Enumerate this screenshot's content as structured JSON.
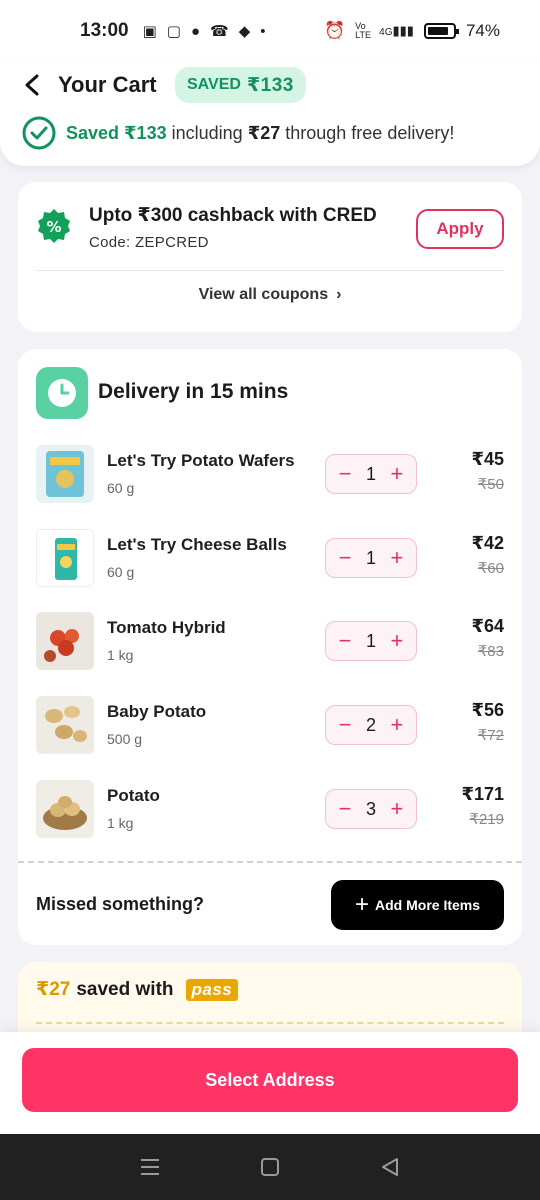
{
  "status_bar": {
    "time": "13:00",
    "network": "4G",
    "volte": "Vo LTE",
    "battery": "74%"
  },
  "header": {
    "title": "Your Cart",
    "saved_badge_label": "SAVED",
    "saved_badge_amount": "₹133",
    "saved_amount": "Saved ₹133",
    "saved_middle": "including",
    "delivery_saving": "₹27",
    "saved_suffix": "through free delivery!"
  },
  "coupon": {
    "title": "Upto ₹300 cashback with CRED",
    "code": "Code: ZEPCRED",
    "apply_label": "Apply",
    "view_all_label": "View all coupons"
  },
  "delivery": {
    "title": "Delivery in 15 mins",
    "items": [
      {
        "name": "Let's Try Potato Wafers",
        "qty": "60 g",
        "count": "1",
        "price": "₹45",
        "mrp": "₹50"
      },
      {
        "name": "Let's Try Cheese Balls",
        "qty": "60 g",
        "count": "1",
        "price": "₹42",
        "mrp": "₹60"
      },
      {
        "name": "Tomato Hybrid",
        "qty": "1 kg",
        "count": "1",
        "price": "₹64",
        "mrp": "₹83"
      },
      {
        "name": "Baby Potato",
        "qty": "500 g",
        "count": "2",
        "price": "₹56",
        "mrp": "₹72"
      },
      {
        "name": "Potato",
        "qty": "1 kg",
        "count": "3",
        "price": "₹171",
        "mrp": "₹219"
      }
    ],
    "missed_label": "Missed something?",
    "add_more_label": "Add More Items"
  },
  "pass": {
    "amount": "₹27",
    "text": "saved with",
    "logo": "pass"
  },
  "cta": {
    "label": "Select Address"
  },
  "colors": {
    "brand_pink": "#ff3466",
    "accent_green": "#12925c",
    "pass_gold": "#e8a800"
  }
}
